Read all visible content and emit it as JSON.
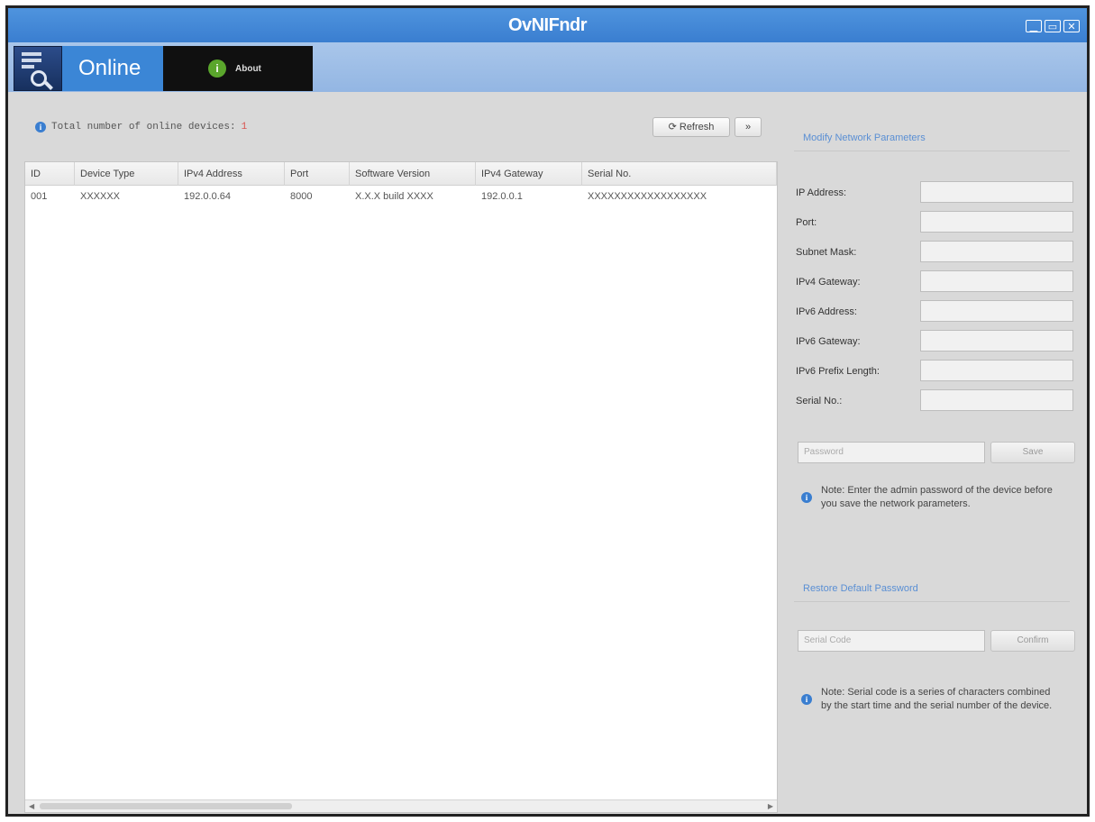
{
  "window": {
    "title": "OvNIFndr",
    "controls": [
      "▁",
      "▭",
      "✕"
    ]
  },
  "nav": {
    "tab_online": "Online",
    "about_icon": "i",
    "tab_about": "About"
  },
  "toolbar": {
    "device_count_label": "Total number of online devices:",
    "device_count": "1",
    "refresh_label": "Refresh",
    "more_label": "»"
  },
  "device_table": {
    "columns": [
      "ID",
      "Device Type",
      "IPv4 Address",
      "Port",
      "Software Version",
      "IPv4 Gateway",
      "Serial No."
    ],
    "rows": [
      [
        "001",
        "XXXXXX",
        "192.0.0.64",
        "8000",
        "X.X.X build XXXX",
        "192.0.0.1",
        "XXXXXXXXXXXXXXXXXX"
      ]
    ]
  },
  "modify": {
    "title": "Modify Network Parameters",
    "fields": [
      {
        "label": "IP Address:",
        "value": ""
      },
      {
        "label": "Port:",
        "value": ""
      },
      {
        "label": "Subnet Mask:",
        "value": ""
      },
      {
        "label": "IPv4 Gateway:",
        "value": ""
      },
      {
        "label": "IPv6 Address:",
        "value": ""
      },
      {
        "label": "IPv6 Gateway:",
        "value": ""
      },
      {
        "label": "IPv6 Prefix Length:",
        "value": ""
      },
      {
        "label": "Serial No.:",
        "value": ""
      }
    ],
    "password_placeholder": "Password",
    "save_label": "Save",
    "note": "Note: Enter the admin password of the device before you save the network parameters."
  },
  "restore": {
    "title": "Restore Default Password",
    "code_placeholder": "Serial Code",
    "confirm_label": "Confirm",
    "note": "Note: Serial code is a series of characters combined by the start time and the serial number of the device."
  },
  "colors": {
    "titlebar": "#3a7ed0",
    "nav_strip": "#9fbfe6",
    "online_tab": "#3b86d6",
    "about_tab": "#101010",
    "accent_text": "#5a8fd4",
    "count": "#d9534f"
  }
}
